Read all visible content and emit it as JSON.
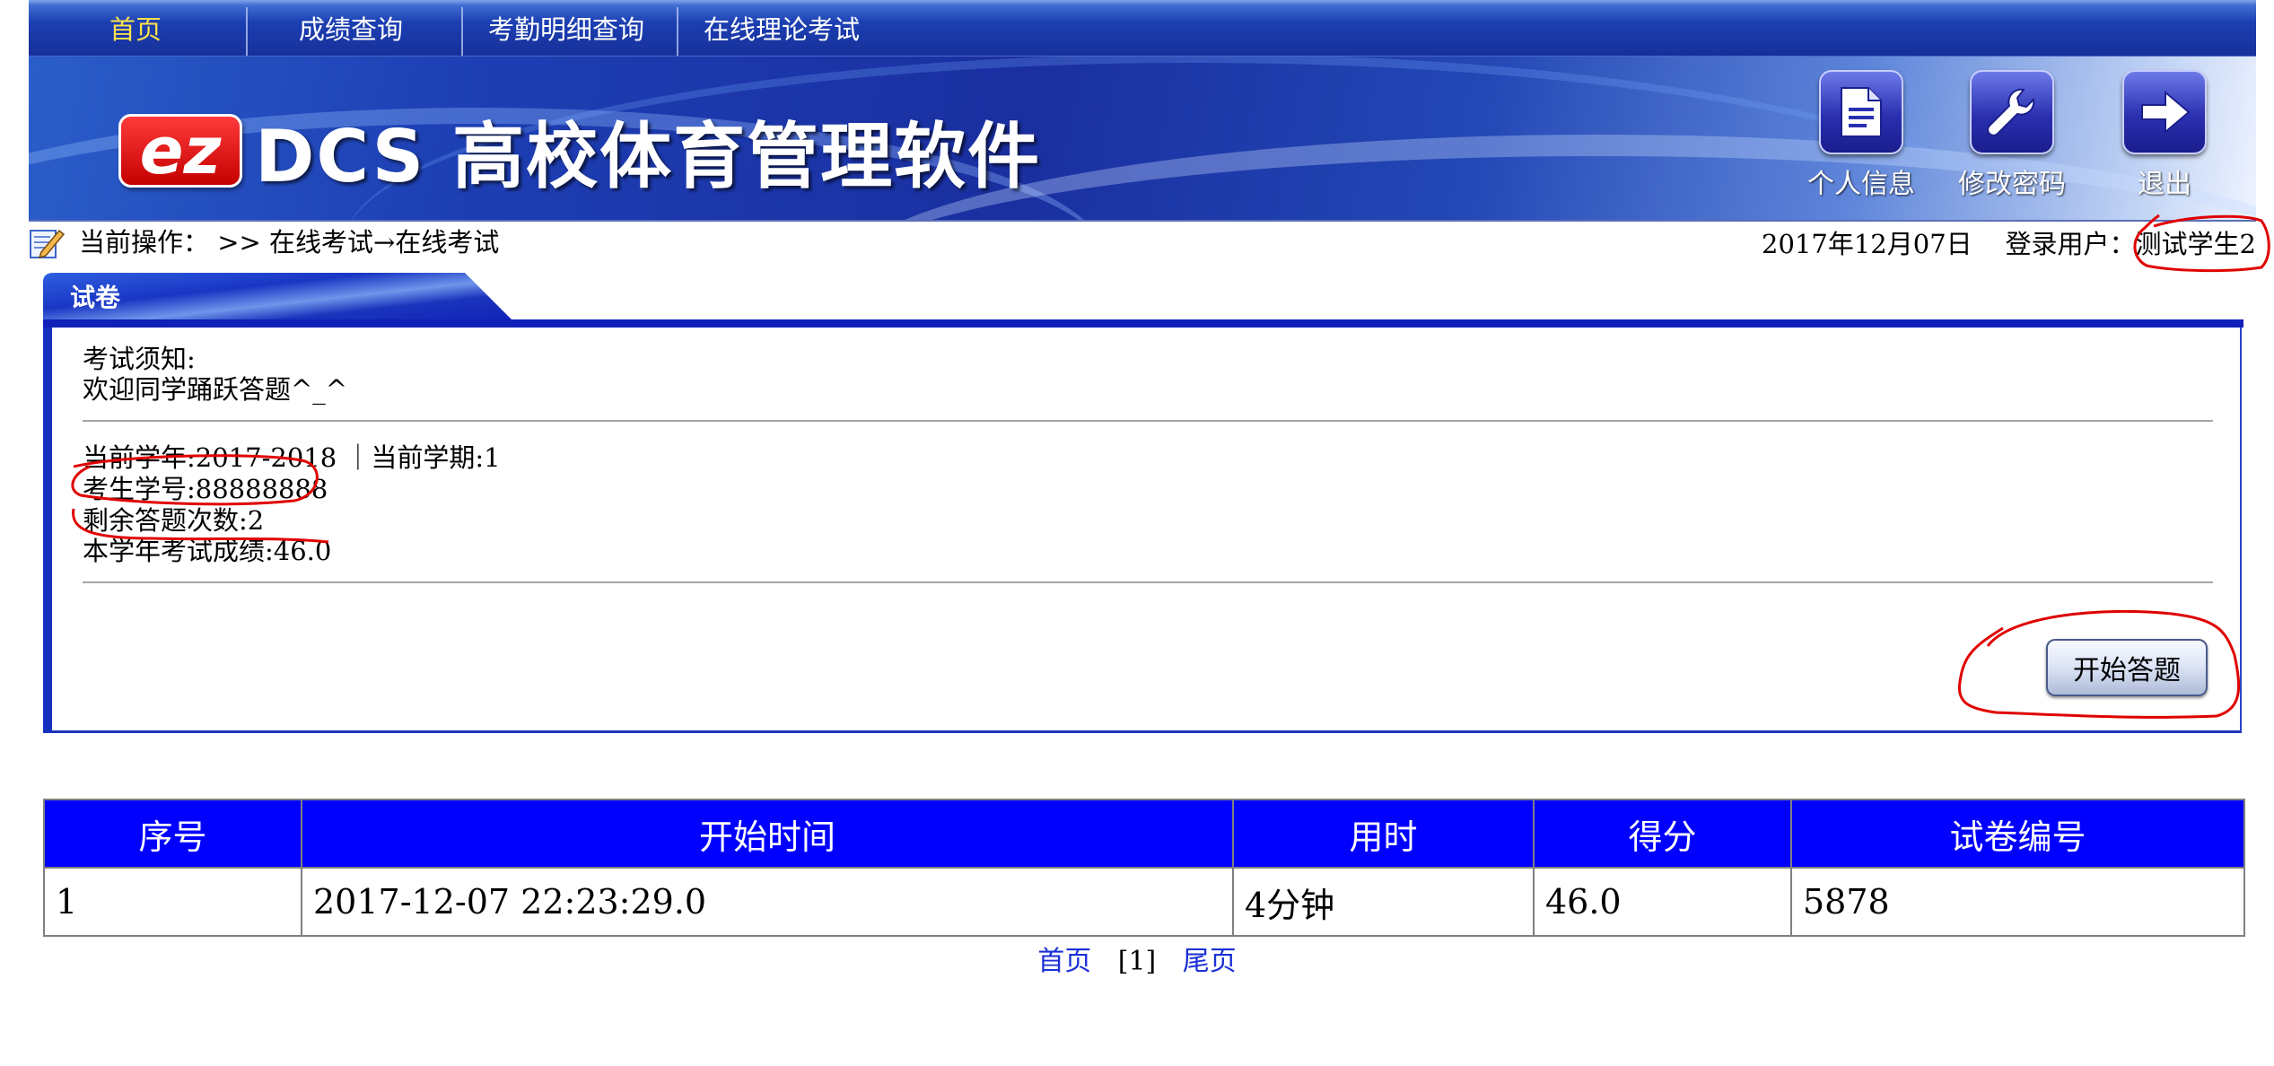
{
  "nav": {
    "items": [
      {
        "label": "首页"
      },
      {
        "label": "成绩查询"
      },
      {
        "label": "考勤明细查询"
      },
      {
        "label": "在线理论考试"
      }
    ]
  },
  "logo": {
    "ez": "ez",
    "title": "DCS 高校体育管理软件"
  },
  "header_buttons": {
    "profile": "个人信息",
    "password": "修改密码",
    "logout": "退出"
  },
  "breadcrumb": {
    "text": "当前操作： >> 在线考试→在线考试"
  },
  "status": {
    "date": "2017年12月07日",
    "user_label": "登录用户：",
    "user_name": "测试学生2"
  },
  "panel": {
    "tab_label": "试卷",
    "notice_title": "考试须知:",
    "notice_text": "欢迎同学踊跃答题^_^",
    "year_term": "当前学年:2017-2018 ｜当前学期:1",
    "student_id": "考生学号:88888888",
    "remaining": "剩余答题次数:2",
    "score": "本学年考试成绩:46.0",
    "start_button": "开始答题"
  },
  "records": {
    "headers": [
      "序号",
      "开始时间",
      "用时",
      "得分",
      "试卷编号"
    ],
    "rows": [
      [
        "1",
        "2017-12-07 22:23:29.0",
        "4分钟",
        "46.0",
        "5878"
      ]
    ]
  },
  "pager": {
    "first": "首页",
    "current": "[1]",
    "last": "尾页"
  },
  "colors": {
    "header_blue": "#1a2fa0",
    "table_header": "#0000ff",
    "active_nav": "#ffe24a",
    "annotation_red": "#e00000"
  }
}
